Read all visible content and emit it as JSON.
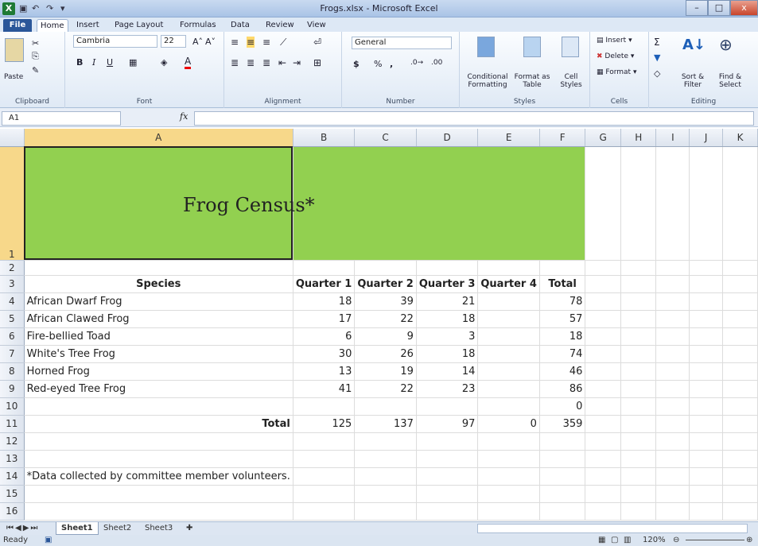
{
  "window": {
    "title": "Frogs.xlsx - Microsoft Excel",
    "app_icon": "X",
    "minimize": "–",
    "restore": "□",
    "close": "x"
  },
  "ribbon_tabs": [
    "File",
    "Home",
    "Insert",
    "Page Layout",
    "Formulas",
    "Data",
    "Review",
    "View"
  ],
  "ribbon": {
    "clipboard": {
      "paste": "Paste",
      "label": "Clipboard"
    },
    "font": {
      "name": "Cambria",
      "size": "22",
      "label": "Font",
      "bold": "B",
      "italic": "I",
      "underline": "U"
    },
    "alignment": {
      "label": "Alignment"
    },
    "number": {
      "format": "General",
      "currency": "$",
      "percent": "%",
      "comma": ",",
      "label": "Number"
    },
    "styles": {
      "conditional": "Conditional Formatting",
      "format_table": "Format as Table",
      "cell_styles": "Cell Styles",
      "label": "Styles"
    },
    "cells": {
      "insert": "Insert",
      "delete": "Delete",
      "format": "Format",
      "label": "Cells"
    },
    "editing": {
      "sum": "Σ",
      "sort": "Sort & Filter",
      "find": "Find & Select",
      "label": "Editing"
    }
  },
  "formula_bar": {
    "name_box": "A1",
    "fx": "fx",
    "value": ""
  },
  "columns": [
    "A",
    "B",
    "C",
    "D",
    "E",
    "F",
    "G",
    "H",
    "I",
    "J",
    "K"
  ],
  "rows": [
    "1",
    "2",
    "3",
    "4",
    "5",
    "6",
    "7",
    "8",
    "9",
    "10",
    "11",
    "12",
    "13",
    "14",
    "15",
    "16"
  ],
  "sheet": {
    "title": "Frog Census*",
    "headers": [
      "Species",
      "Quarter 1",
      "Quarter 2",
      "Quarter 3",
      "Quarter 4",
      "Total"
    ],
    "data": [
      [
        "African Dwarf Frog",
        "18",
        "39",
        "21",
        "",
        "78"
      ],
      [
        "African Clawed Frog",
        "17",
        "22",
        "18",
        "",
        "57"
      ],
      [
        "Fire-bellied Toad",
        "6",
        "9",
        "3",
        "",
        "18"
      ],
      [
        "White's Tree Frog",
        "30",
        "26",
        "18",
        "",
        "74"
      ],
      [
        "Horned Frog",
        "13",
        "19",
        "14",
        "",
        "46"
      ],
      [
        "Red-eyed Tree Frog",
        "41",
        "22",
        "23",
        "",
        "86"
      ],
      [
        "",
        "",
        "",
        "",
        "",
        "0"
      ]
    ],
    "total_row": [
      "Total",
      "125",
      "137",
      "97",
      "0",
      "359"
    ],
    "footnote": "*Data collected by committee member volunteers."
  },
  "sheet_tabs": [
    "Sheet1",
    "Sheet2",
    "Sheet3"
  ],
  "status": {
    "ready": "Ready",
    "zoom": "120%"
  },
  "colors": {
    "title_fill": "#92d050",
    "file_tab": "#2a5699"
  }
}
